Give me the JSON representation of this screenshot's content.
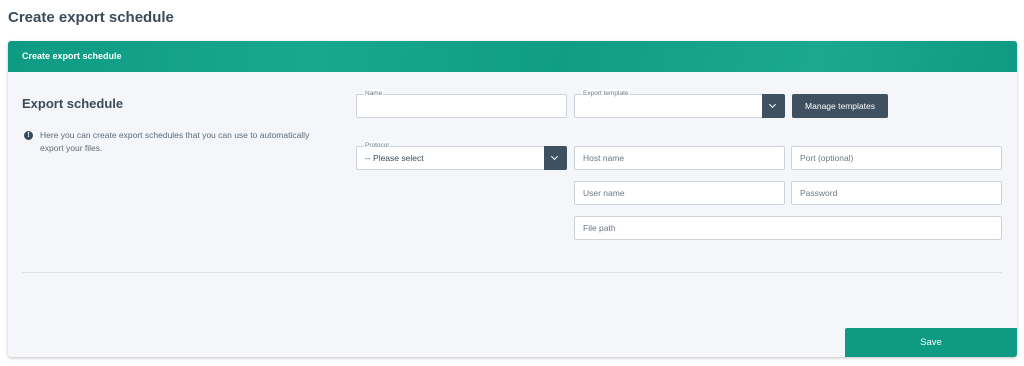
{
  "page": {
    "title": "Create export schedule"
  },
  "panel": {
    "header_title": "Create export schedule",
    "section_title": "Export schedule",
    "info_text": "Here you can create export schedules that you can use to automatically export your files."
  },
  "form": {
    "name": {
      "legend": "Name",
      "value": ""
    },
    "export_template": {
      "legend": "Export template",
      "value": ""
    },
    "manage_templates_label": "Manage templates",
    "protocol": {
      "legend": "Protocol",
      "value": "-- Please select"
    },
    "host_name": {
      "placeholder": "Host name"
    },
    "port": {
      "placeholder": "Port (optional)"
    },
    "user_name": {
      "placeholder": "User name"
    },
    "password": {
      "placeholder": "Password"
    },
    "file_path": {
      "placeholder": "File path"
    }
  },
  "actions": {
    "save_label": "Save"
  },
  "colors": {
    "accent": "#0e9a83",
    "dark_button": "#3f5060"
  },
  "icons": {
    "info": "info-icon",
    "select_arrow": "chevron-down-icon"
  }
}
